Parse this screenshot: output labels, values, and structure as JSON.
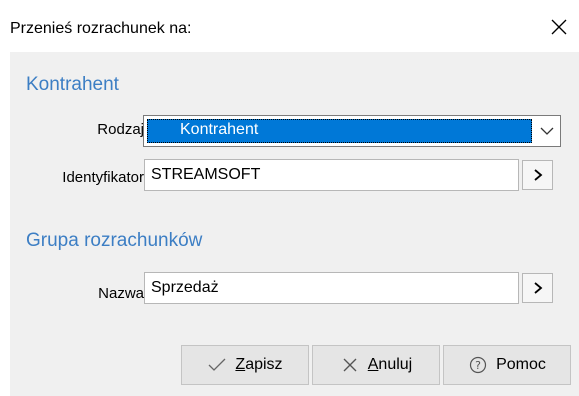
{
  "window": {
    "title": "Przenieś rozrachunek na:"
  },
  "section_kontrahent": {
    "header": "Kontrahent",
    "rodzaj_label": "Rodzaj",
    "rodzaj_value": "Kontrahent",
    "identyfikator_label": "Identyfikator",
    "identyfikator_value": "STREAMSOFT"
  },
  "section_grupa": {
    "header": "Grupa rozrachunków",
    "nazwa_label": "Nazwa",
    "nazwa_value": "Sprzedaż"
  },
  "buttons": {
    "save": "Zapisz",
    "cancel": "Anuluj",
    "help": "Pomoc"
  },
  "icons": {
    "close": "close-icon",
    "dropdown": "chevron-down-icon",
    "select_more": "chevron-right-icon",
    "save": "checkmark-icon",
    "cancel": "x-icon",
    "help": "question-circle-icon"
  },
  "colors": {
    "accent": "#3c7ec4",
    "selection": "#0078d7",
    "background": "#f0f0f0"
  }
}
